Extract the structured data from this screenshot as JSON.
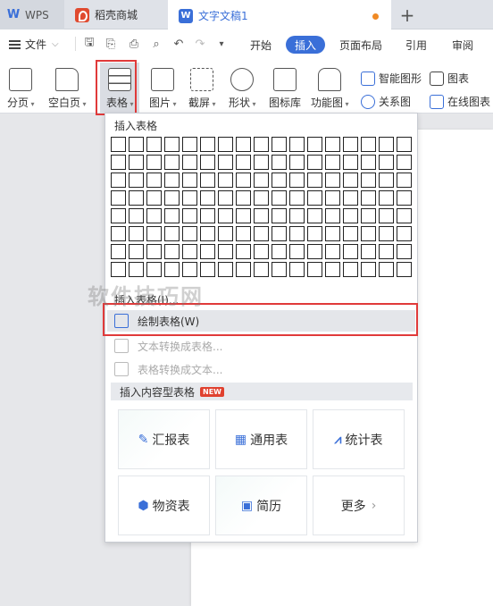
{
  "titlebar": {
    "tabs": [
      {
        "label": "WPS",
        "icon": "wps-logo-icon"
      },
      {
        "label": "稻壳商城",
        "icon": "daoke-logo-icon"
      },
      {
        "label": "文字文稿1",
        "icon": "writer-doc-icon"
      }
    ],
    "add_tab": "+"
  },
  "menubar": {
    "file_label": "文件",
    "tabs": [
      "开始",
      "插入",
      "页面布局",
      "引用",
      "审阅"
    ],
    "active_tab": "插入"
  },
  "ribbon": {
    "buttons": [
      {
        "label": "分页",
        "icon": "page-break-icon"
      },
      {
        "label": "空白页",
        "icon": "blank-page-icon"
      },
      {
        "label": "表格",
        "icon": "table-icon"
      },
      {
        "label": "图片",
        "icon": "picture-icon"
      },
      {
        "label": "截屏",
        "icon": "screenshot-icon"
      },
      {
        "label": "形状",
        "icon": "shape-icon"
      },
      {
        "label": "图标库",
        "icon": "icon-library-icon"
      },
      {
        "label": "功能图",
        "icon": "function-chart-icon"
      }
    ],
    "small_buttons": [
      {
        "label": "智能图形",
        "icon": "smart-art-icon"
      },
      {
        "label": "图表",
        "icon": "chart-icon"
      },
      {
        "label": "关系图",
        "icon": "relation-chart-icon"
      },
      {
        "label": "在线图表",
        "icon": "online-chart-icon"
      }
    ]
  },
  "table_menu": {
    "title": "插入表格",
    "grid_cols": 17,
    "grid_rows": 8,
    "insert_table_label": "插入表格(I)...",
    "items": [
      {
        "label": "绘制表格(W)",
        "state": "selected",
        "icon": "draw-table-icon"
      },
      {
        "label": "文本转换成表格...",
        "state": "disabled",
        "icon": "text-to-table-icon"
      },
      {
        "label": "表格转换成文本...",
        "state": "disabled",
        "icon": "table-to-text-icon"
      }
    ],
    "section_title": "插入内容型表格",
    "section_badge": "NEW",
    "cards": [
      {
        "label": "汇报表",
        "icon": "report-edit-icon"
      },
      {
        "label": "通用表",
        "icon": "grid-icon"
      },
      {
        "label": "统计表",
        "icon": "stats-chart-icon"
      },
      {
        "label": "物资表",
        "icon": "box-icon"
      },
      {
        "label": "简历",
        "icon": "resume-icon"
      },
      {
        "label": "更多",
        "icon": "chevron-right-icon"
      }
    ]
  },
  "watermark": "软件技巧网"
}
